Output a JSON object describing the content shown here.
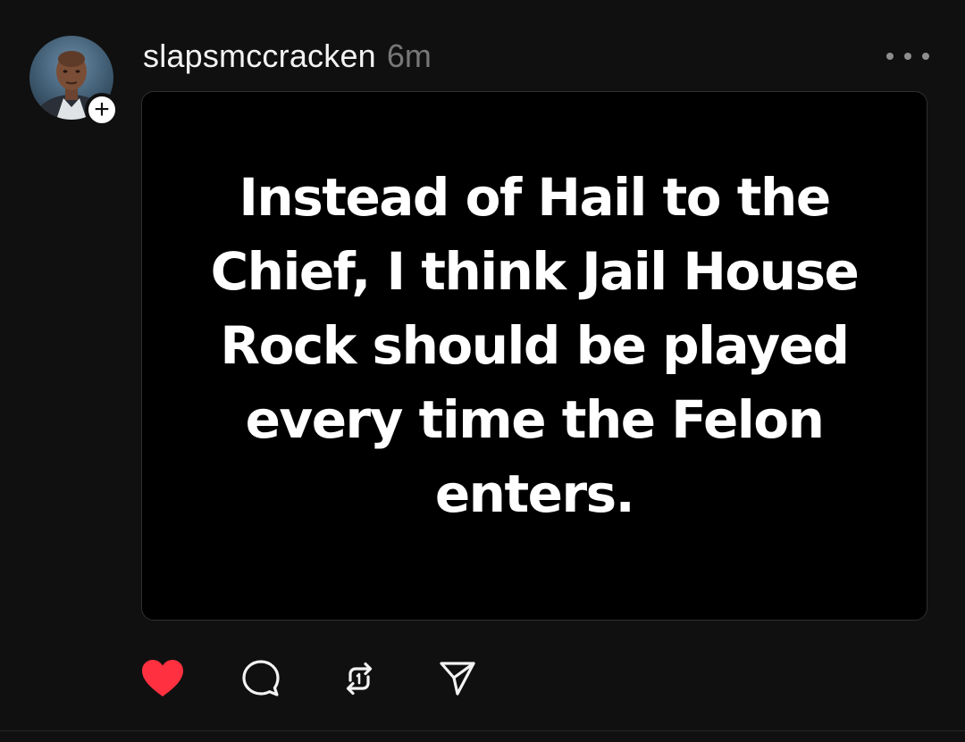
{
  "post": {
    "username": "slapsmccracken",
    "timestamp": "6m",
    "follow_badge": "+",
    "image_text": "Instead of Hail to the Chief, I think Jail House Rock should be played every time the Felon enters."
  },
  "icons": {
    "more": "more-horizontal-icon",
    "like": "heart-icon",
    "reply": "comment-icon",
    "repost": "repost-icon",
    "share": "send-icon"
  },
  "state": {
    "liked": true
  },
  "colors": {
    "background": "#101010",
    "like_active": "#ff3040",
    "text_primary": "#f3f3f3",
    "text_secondary": "#777777"
  }
}
